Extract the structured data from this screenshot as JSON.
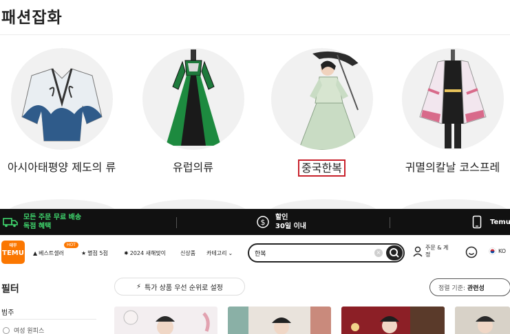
{
  "category": {
    "title": "패션잡화",
    "items": [
      {
        "label": "아시아태평양 제도의 류",
        "highlighted": false
      },
      {
        "label": "유럽의류",
        "highlighted": false
      },
      {
        "label": "중국한복",
        "highlighted": true
      },
      {
        "label": "귀멸의칼날 코스프레",
        "highlighted": false
      }
    ],
    "highlight_color": "#c8202a"
  },
  "temu": {
    "promo": {
      "shipping_line1": "모든 주문 무료 배송",
      "shipping_line2": "독점 혜택",
      "discount_line1": "할인",
      "discount_line2": "30일 이내",
      "app": "Temu"
    },
    "logo_text": "TEMU",
    "logo_tiny": "테무",
    "nav": {
      "bestsellers": "베스트셀러",
      "hot_badge": "HOT",
      "five_star": "별점 5점",
      "new_year": "2024 새해맞이",
      "new_items": "신상품",
      "categories": "카테고리"
    },
    "search": {
      "value": "한복"
    },
    "orders": "주문 & 계정",
    "language": "KO",
    "filter_title": "필터",
    "filter_category": "범주",
    "filter_option": "여성 원피스",
    "priority_pill": "특가 상품 우선 순위로 설정",
    "sort_label": "정렬 기준:",
    "sort_value": "관련성",
    "brand_color": "#fb7701",
    "promo_green": "#40d76e"
  }
}
